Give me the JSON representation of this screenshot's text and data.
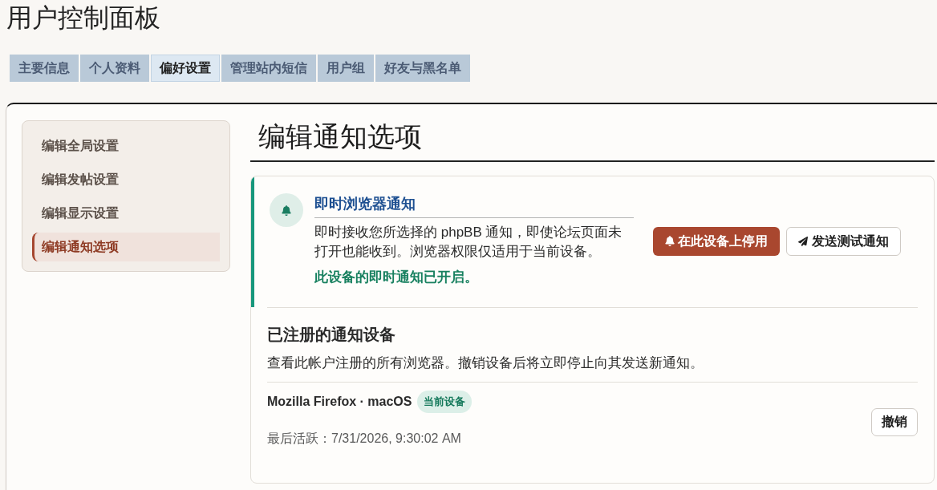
{
  "page_title": "用户控制面板",
  "tabs": [
    {
      "label": "主要信息",
      "selected": false
    },
    {
      "label": "个人资料",
      "selected": false
    },
    {
      "label": "偏好设置",
      "selected": true
    },
    {
      "label": "管理站内短信",
      "selected": false
    },
    {
      "label": "用户组",
      "selected": false
    },
    {
      "label": "好友与黑名单",
      "selected": false
    }
  ],
  "sidebar": {
    "items": [
      {
        "label": "编辑全局设置",
        "selected": false
      },
      {
        "label": "编辑发帖设置",
        "selected": false
      },
      {
        "label": "编辑显示设置",
        "selected": false
      },
      {
        "label": "编辑通知选项",
        "selected": true
      }
    ]
  },
  "heading": "编辑通知选项",
  "push_panel": {
    "title": "即时浏览器通知",
    "description": "即时接收您所选择的 phpBB 通知，即使论坛页面未打开也能收到。浏览器权限仅适用于当前设备。",
    "status": "此设备的即时通知已开启。",
    "buttons": [
      {
        "kind": "disable",
        "label": "在此设备上停用"
      },
      {
        "kind": "test",
        "label": "发送测试通知"
      }
    ]
  },
  "devices": {
    "title": "已注册的通知设备",
    "description": "查看此帐户注册的所有浏览器。撤销设备后将立即停止向其发送新通知。",
    "items": [
      {
        "name": "Mozilla Firefox · macOS",
        "badge": "当前设备",
        "last_active": "最后活跃：7/31/2026, 9:30:02 AM",
        "action": "撤销"
      }
    ]
  }
}
